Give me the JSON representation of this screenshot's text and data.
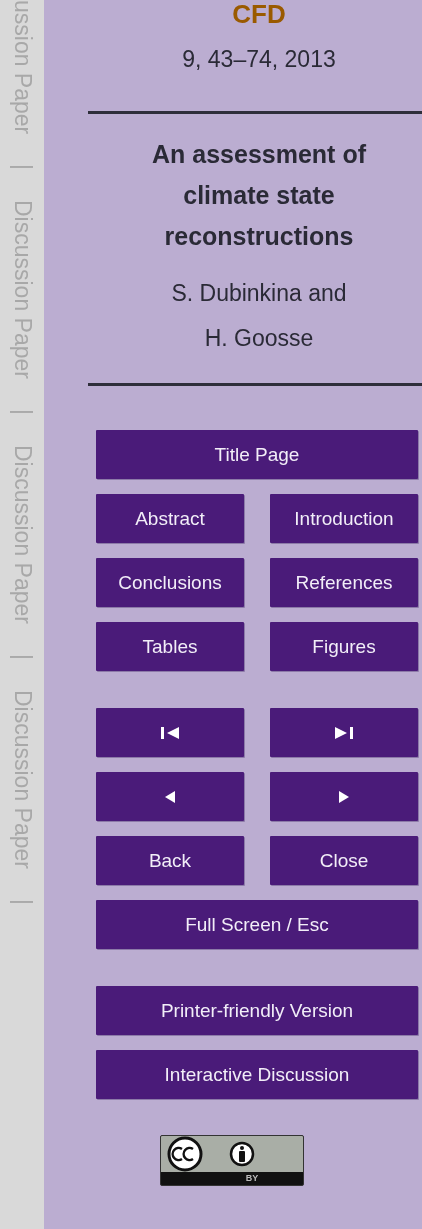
{
  "margin_text": [
    "ussion Paper",
    "|",
    "Discussion Paper",
    "|",
    "Discussion Paper",
    "|",
    "Discussion Paper",
    "|"
  ],
  "journal": "CFD",
  "citation": "9, 43–74, 2013",
  "title": "An assessment of climate state reconstructions",
  "authors": "S. Dubinkina and H. Goosse",
  "nav_top": [
    [
      "Title Page"
    ],
    [
      "Abstract",
      "Introduction"
    ],
    [
      "Conclusions",
      "References"
    ],
    [
      "Tables",
      "Figures"
    ]
  ],
  "nav_bottom": [
    [
      "Back",
      "Close"
    ],
    [
      "Full Screen / Esc"
    ]
  ],
  "nav_extra": [
    "Printer-friendly Version",
    "Interactive Discussion"
  ],
  "license_badge": {
    "label": "BY"
  }
}
